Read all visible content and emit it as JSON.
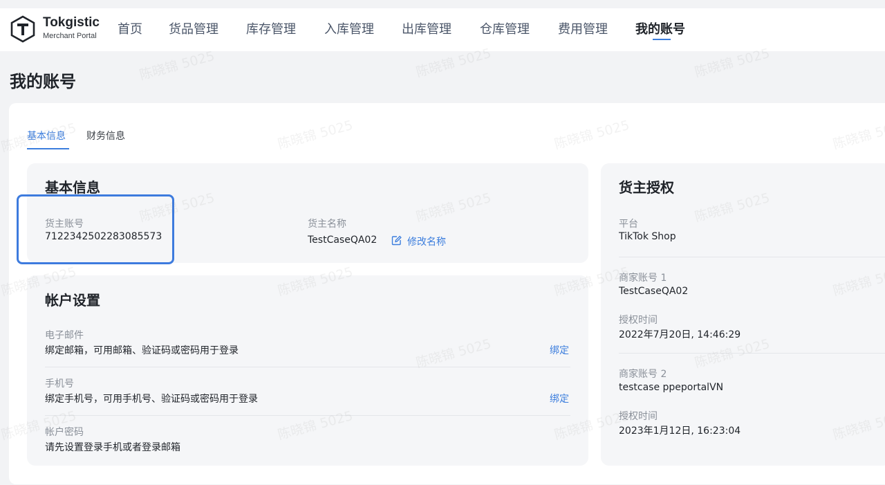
{
  "brand": {
    "name": "Tokgistic",
    "subtitle": "Merchant Portal"
  },
  "nav": {
    "items": [
      {
        "label": "首页"
      },
      {
        "label": "货品管理"
      },
      {
        "label": "库存管理"
      },
      {
        "label": "入库管理"
      },
      {
        "label": "出库管理"
      },
      {
        "label": "仓库管理"
      },
      {
        "label": "费用管理"
      },
      {
        "label": "我的账号",
        "active": true
      }
    ]
  },
  "page_title": "我的账号",
  "tabs": [
    {
      "label": "基本信息",
      "active": true
    },
    {
      "label": "财务信息",
      "active": false
    }
  ],
  "basic_info": {
    "title": "基本信息",
    "owner_account_label": "货主账号",
    "owner_account_value": "7122342502283085573",
    "owner_name_label": "货主名称",
    "owner_name_value": "TestCaseQA02",
    "edit_name_label": "修改名称"
  },
  "account_settings": {
    "title": "帐户设置",
    "email": {
      "label": "电子邮件",
      "desc": "绑定邮箱，可用邮箱、验证码或密码用于登录",
      "action": "绑定"
    },
    "phone": {
      "label": "手机号",
      "desc": "绑定手机号，可用手机号、验证码或密码用于登录",
      "action": "绑定"
    },
    "password": {
      "label": "帐户密码",
      "desc": "请先设置登录手机或者登录邮箱"
    }
  },
  "authorization": {
    "title": "货主授权",
    "platform_label": "平台",
    "platform_value": "TikTok Shop",
    "merchants": [
      {
        "label": "商家账号 1",
        "value": "TestCaseQA02",
        "time_label": "授权时间",
        "time_value": "2022年7月20日, 14:46:29"
      },
      {
        "label": "商家账号 2",
        "value": "testcase ppeportalVN",
        "time_label": "授权时间",
        "time_value": "2023年1月12日, 16:23:04"
      }
    ]
  },
  "watermark_text": "陈晓锦 5025",
  "colors": {
    "accent": "#3b7ddd",
    "highlight_border": "#3d7bde",
    "background": "#f2f3f5",
    "panel": "#f5f6f8"
  }
}
